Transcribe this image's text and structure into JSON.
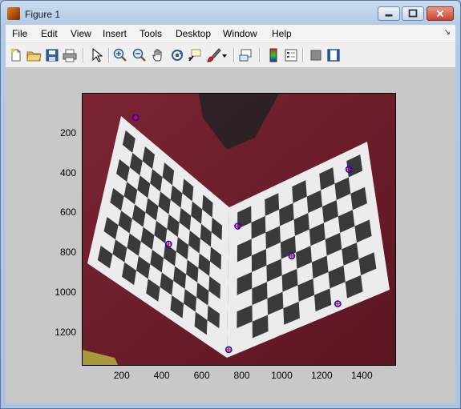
{
  "window": {
    "title": "Figure 1"
  },
  "menu": [
    "File",
    "Edit",
    "View",
    "Insert",
    "Tools",
    "Desktop",
    "Window",
    "Help"
  ],
  "menu_arrow": "↘",
  "toolbar": [
    "new-figure-icon",
    "open-file-icon",
    "save-icon",
    "print-icon",
    "edit-plot-arrow-icon",
    "zoom-in-icon",
    "zoom-out-icon",
    "pan-hand-icon",
    "rotate-3d-icon",
    "data-cursor-icon",
    "brush-icon",
    "brush-dropdown-icon",
    "link-plot-icon",
    "insert-colorbar-icon",
    "insert-legend-icon",
    "hide-plot-tools-icon",
    "show-plot-tools-icon"
  ],
  "axes": {
    "y_ticks": [
      "200",
      "400",
      "600",
      "800",
      "1000",
      "1200"
    ],
    "x_ticks": [
      "200",
      "400",
      "600",
      "800",
      "1000",
      "1200",
      "1400"
    ]
  },
  "chart_data": {
    "type": "scatter",
    "description_markers": "blue circles with red plus markers over image",
    "x": [
      265,
      430,
      775,
      1045,
      1330,
      1275,
      730
    ],
    "y": [
      120,
      755,
      665,
      815,
      380,
      1055,
      1285
    ],
    "xlim": [
      0,
      1570
    ],
    "ylim": [
      1370,
      0
    ],
    "marker_color": "#0000ff",
    "marker_cross_color": "#ff0000"
  }
}
